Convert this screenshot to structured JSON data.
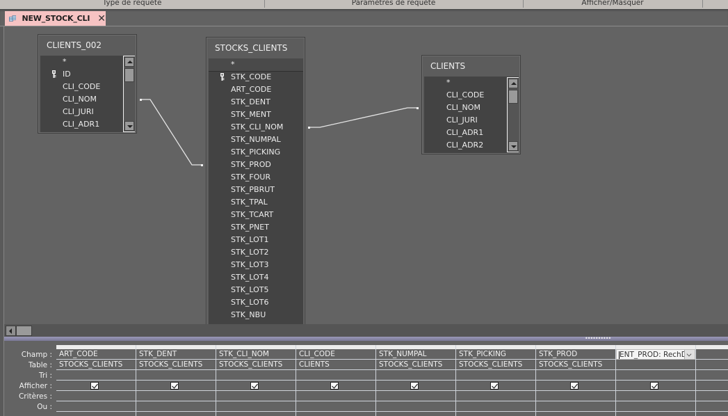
{
  "ribbon": {
    "groups": [
      "Type de requête",
      "Paramètres de requête",
      "Afficher/Masquer"
    ]
  },
  "document_tab": {
    "label": "NEW_STOCK_CLI",
    "icon": "query-design-icon",
    "close_icon": "close-icon",
    "color": "#f6c3c3"
  },
  "tables": [
    {
      "name": "CLIENTS_002",
      "fields": [
        {
          "name": "*",
          "key": false
        },
        {
          "name": "ID",
          "key": true
        },
        {
          "name": "CLI_CODE",
          "key": false
        },
        {
          "name": "CLI_NOM",
          "key": false
        },
        {
          "name": "CLI_JURI",
          "key": false
        },
        {
          "name": "CLI_ADR1",
          "key": false
        }
      ]
    },
    {
      "name": "STOCKS_CLIENTS",
      "fields": [
        {
          "name": "*",
          "key": false
        },
        {
          "name": "STK_CODE",
          "key": true
        },
        {
          "name": "ART_CODE",
          "key": false
        },
        {
          "name": "STK_DENT",
          "key": false
        },
        {
          "name": "STK_MENT",
          "key": false
        },
        {
          "name": "STK_CLI_NOM",
          "key": false
        },
        {
          "name": "STK_NUMPAL",
          "key": false
        },
        {
          "name": "STK_PICKING",
          "key": false
        },
        {
          "name": "STK_PROD",
          "key": false
        },
        {
          "name": "STK_FOUR",
          "key": false
        },
        {
          "name": "STK_PBRUT",
          "key": false
        },
        {
          "name": "STK_TPAL",
          "key": false
        },
        {
          "name": "STK_TCART",
          "key": false
        },
        {
          "name": "STK_PNET",
          "key": false
        },
        {
          "name": "STK_LOT1",
          "key": false
        },
        {
          "name": "STK_LOT2",
          "key": false
        },
        {
          "name": "STK_LOT3",
          "key": false
        },
        {
          "name": "STK_LOT4",
          "key": false
        },
        {
          "name": "STK_LOT5",
          "key": false
        },
        {
          "name": "STK_LOT6",
          "key": false
        },
        {
          "name": "STK_NBU",
          "key": false
        }
      ]
    },
    {
      "name": "CLIENTS",
      "fields": [
        {
          "name": "*",
          "key": false
        },
        {
          "name": "CLI_CODE",
          "key": false
        },
        {
          "name": "CLI_NOM",
          "key": false
        },
        {
          "name": "CLI_JURI",
          "key": false
        },
        {
          "name": "CLI_ADR1",
          "key": false
        },
        {
          "name": "CLI_ADR2",
          "key": false
        }
      ]
    }
  ],
  "joins": [
    {
      "from_table": "CLIENTS_002",
      "from_field": "CLI_CODE",
      "to_table": "STOCKS_CLIENTS",
      "to_field": "STK_PROD"
    },
    {
      "from_table": "STOCKS_CLIENTS",
      "from_field": "STK_CLI_NOM",
      "to_table": "CLIENTS",
      "to_field": "CLI_CODE"
    }
  ],
  "qbe": {
    "row_labels": {
      "field": "Champ :",
      "table": "Table :",
      "sort": "Tri :",
      "show": "Afficher :",
      "criteria": "Critères :",
      "or": "Ou :"
    },
    "columns": [
      {
        "field": "ART_CODE",
        "table": "STOCKS_CLIENTS",
        "sort": "",
        "show": true,
        "criteria": "",
        "or": ""
      },
      {
        "field": "STK_DENT",
        "table": "STOCKS_CLIENTS",
        "sort": "",
        "show": true,
        "criteria": "",
        "or": ""
      },
      {
        "field": "STK_CLI_NOM",
        "table": "STOCKS_CLIENTS",
        "sort": "",
        "show": true,
        "criteria": "",
        "or": ""
      },
      {
        "field": "CLI_CODE",
        "table": "CLIENTS",
        "sort": "",
        "show": true,
        "criteria": "",
        "or": ""
      },
      {
        "field": "STK_NUMPAL",
        "table": "STOCKS_CLIENTS",
        "sort": "",
        "show": true,
        "criteria": "",
        "or": ""
      },
      {
        "field": "STK_PICKING",
        "table": "STOCKS_CLIENTS",
        "sort": "",
        "show": true,
        "criteria": "",
        "or": ""
      },
      {
        "field": "STK_PROD",
        "table": "STOCKS_CLIENTS",
        "sort": "",
        "show": true,
        "criteria": "",
        "or": ""
      },
      {
        "field": "ENT_PROD: RechD",
        "table": "",
        "sort": "",
        "show": true,
        "criteria": "",
        "or": "",
        "editing": true
      },
      {
        "field": "",
        "table": "",
        "sort": "",
        "show": false,
        "criteria": "",
        "or": ""
      }
    ]
  }
}
